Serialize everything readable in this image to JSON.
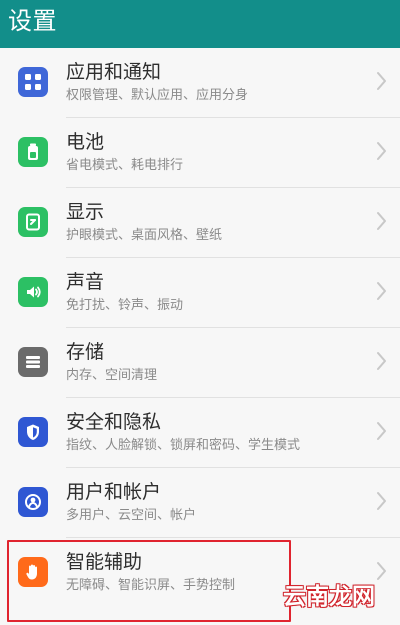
{
  "header": {
    "title": "设置",
    "color": "#128e8a"
  },
  "settings": {
    "items": [
      {
        "label": "应用和通知",
        "sublabel": "权限管理、默认应用、应用分身",
        "icon": "apps-icon",
        "color": "#3f67d8"
      },
      {
        "label": "电池",
        "sublabel": "省电模式、耗电排行",
        "icon": "battery-icon",
        "color": "#2cc064"
      },
      {
        "label": "显示",
        "sublabel": "护眼模式、桌面风格、壁纸",
        "icon": "display-icon",
        "color": "#2cc064"
      },
      {
        "label": "声音",
        "sublabel": "免打扰、铃声、振动",
        "icon": "sound-icon",
        "color": "#2cc064"
      },
      {
        "label": "存储",
        "sublabel": "内存、空间清理",
        "icon": "storage-icon",
        "color": "#6b6b6b"
      },
      {
        "label": "安全和隐私",
        "sublabel": "指纹、人脸解锁、锁屏和密码、学生模式",
        "icon": "shield-icon",
        "color": "#2f57d3"
      },
      {
        "label": "用户和帐户",
        "sublabel": "多用户、云空间、帐户",
        "icon": "user-icon",
        "color": "#2f57d3"
      },
      {
        "label": "智能辅助",
        "sublabel": "无障碍、智能识屏、手势控制",
        "icon": "hand-icon",
        "color": "#ff6a1a"
      }
    ]
  },
  "overlay": {
    "highlight_color": "#e0242f",
    "watermark_text": "云南龙网",
    "watermark_color": "#d1232b"
  }
}
